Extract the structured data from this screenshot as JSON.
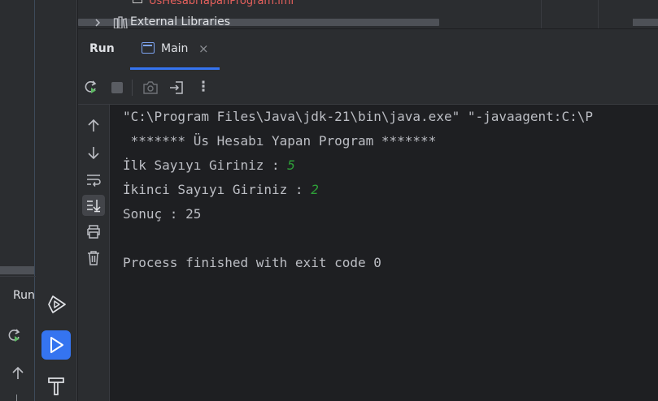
{
  "left_panel": {
    "run_label": "Run"
  },
  "project_tree": {
    "file_label": "UsHesabiYapanProgram.iml",
    "external_libraries_label": "External Libraries"
  },
  "run_panel": {
    "title": "Run",
    "tab_label": "Main",
    "tab_close": "×"
  },
  "toolbar": {
    "more_label": "⋮"
  },
  "console": {
    "lines": [
      "\"C:\\Program Files\\Java\\jdk-21\\bin\\java.exe\" \"-javaagent:C:\\P",
      " ******* Üs Hesabı Yapan Program *******",
      "İlk Sayıyı Giriniz : ",
      "İkinci Sayıyı Giriniz : ",
      "Sonuç : 25",
      "",
      "Process finished with exit code 0"
    ],
    "inputs": {
      "first": "5",
      "second": "2"
    }
  },
  "colors": {
    "accent": "#3574f0",
    "input_green": "#2e9f38",
    "error_red": "#e5605c"
  }
}
